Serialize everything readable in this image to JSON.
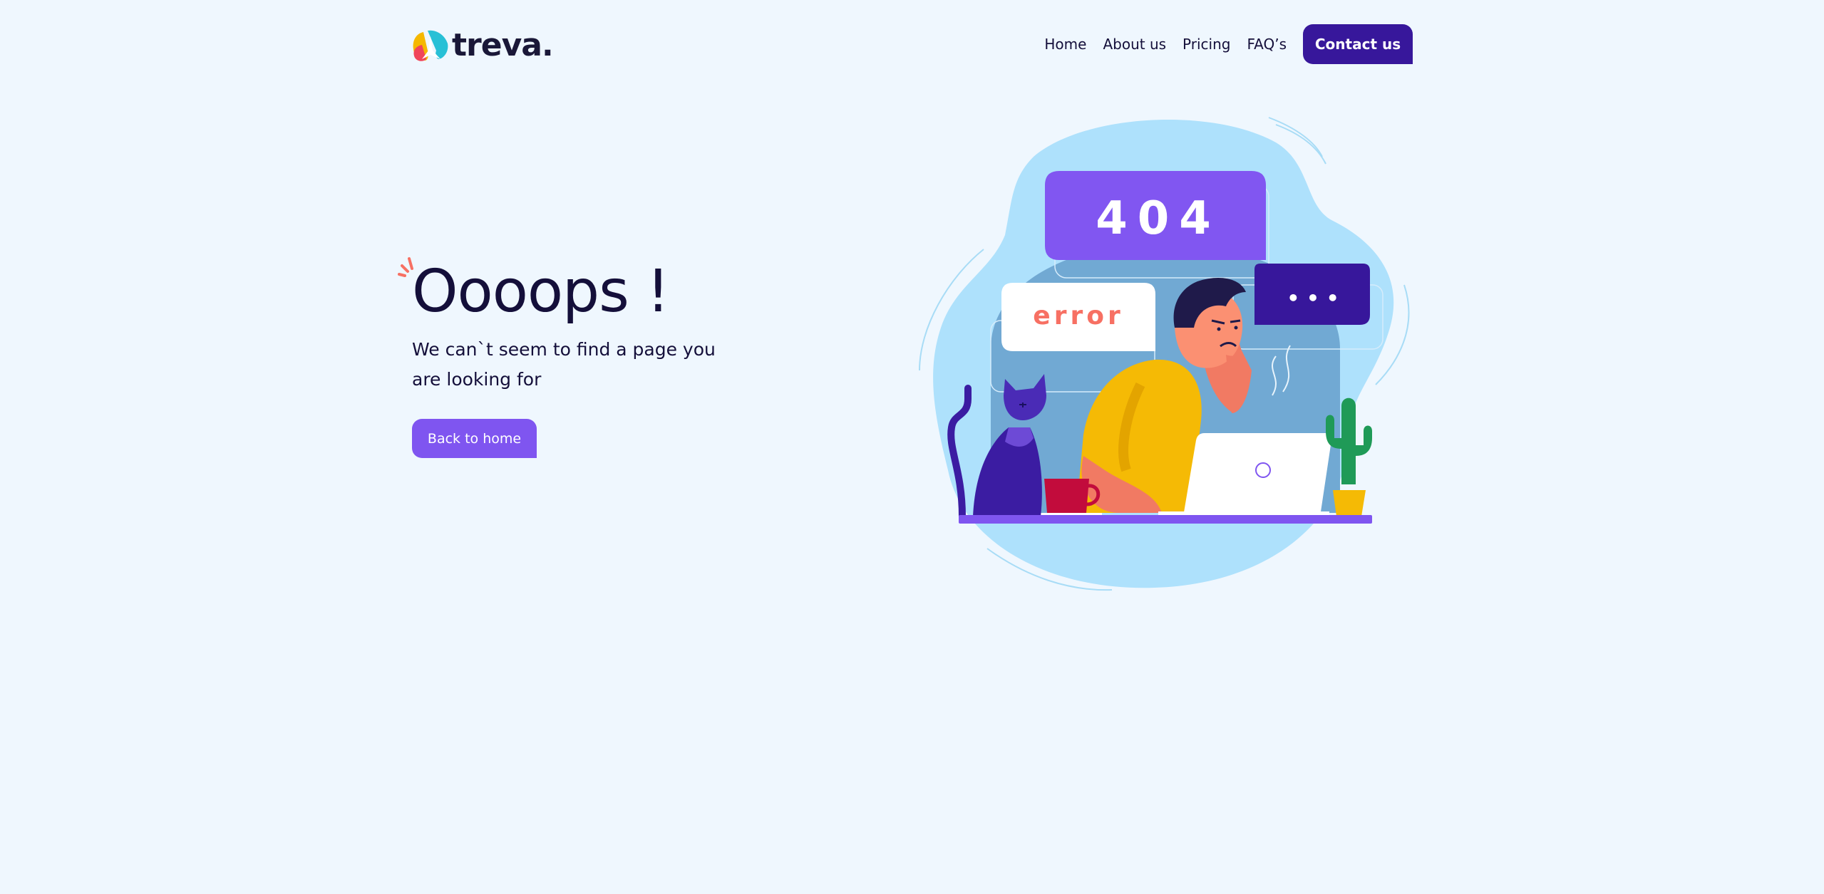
{
  "brand": {
    "name": "treva.",
    "colors": {
      "background": "#eff7fe",
      "primary_dark": "#37179b",
      "primary": "#7f55f0",
      "text": "#140f3a",
      "accent_coral": "#f77063"
    }
  },
  "nav": {
    "items": [
      {
        "label": "Home"
      },
      {
        "label": "About us"
      },
      {
        "label": "Pricing"
      },
      {
        "label": "FAQ’s"
      }
    ],
    "contact_label": "Contact us"
  },
  "hero": {
    "title": "Oooops !",
    "subtitle": "We can`t seem to find a page you are looking for",
    "back_label": "Back to home"
  },
  "illustration": {
    "code_badge": "404",
    "error_badge": "error",
    "typing_badge": "• • •",
    "icons": [
      "logo-mark-icon",
      "spark-icon",
      "cat-icon",
      "cactus-icon",
      "laptop-icon",
      "mug-icon",
      "person-icon"
    ]
  }
}
